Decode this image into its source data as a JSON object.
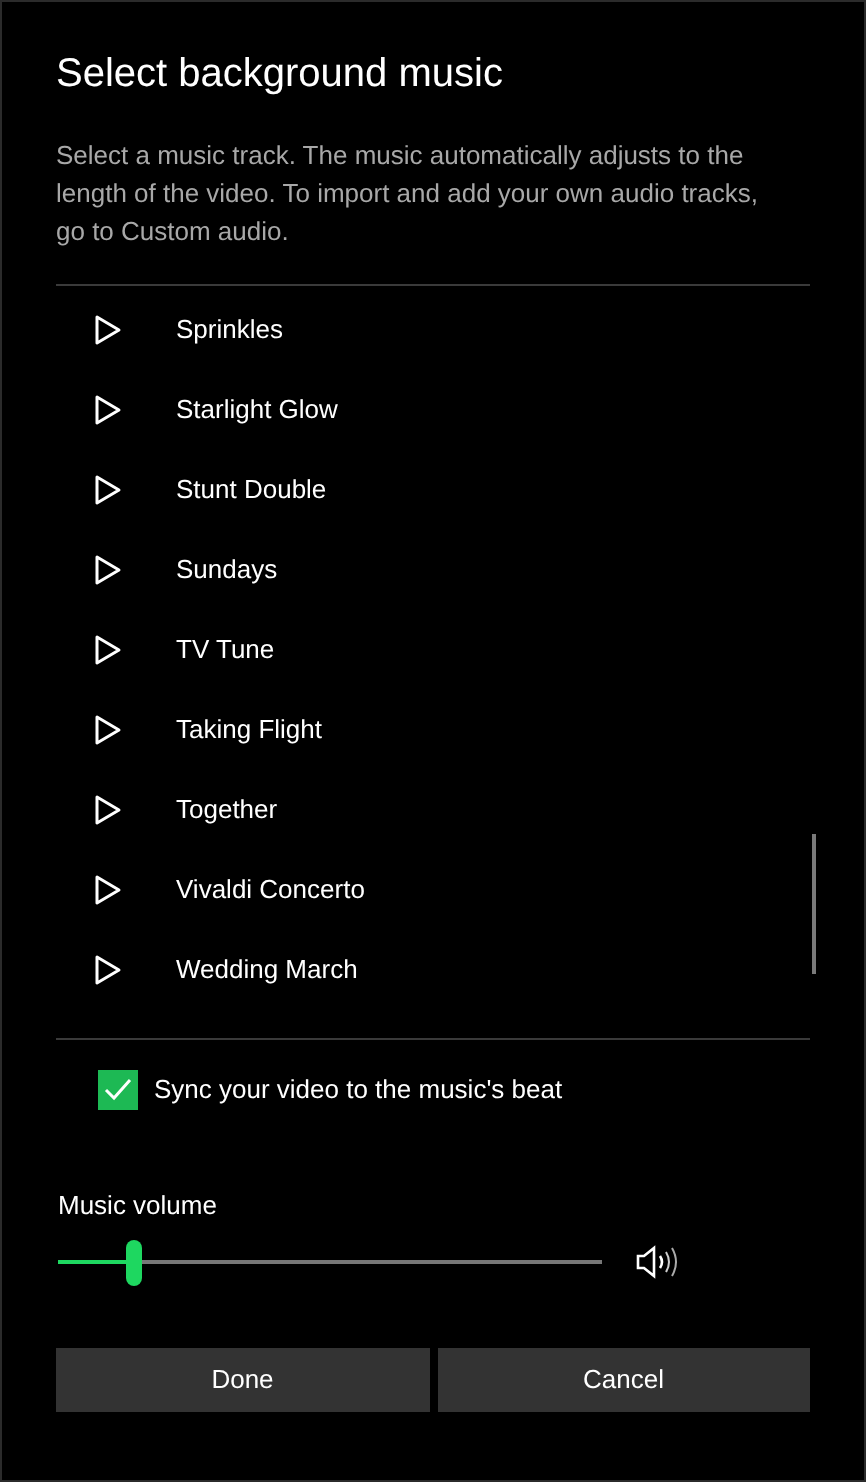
{
  "title": "Select background music",
  "description": "Select a music track. The music automatically adjusts to the length of the video. To import and add your own audio tracks, go to Custom audio.",
  "tracks": [
    {
      "name": "Sprinkles"
    },
    {
      "name": "Starlight Glow"
    },
    {
      "name": "Stunt Double"
    },
    {
      "name": "Sundays"
    },
    {
      "name": "TV Tune"
    },
    {
      "name": "Taking Flight"
    },
    {
      "name": "Together"
    },
    {
      "name": "Vivaldi Concerto"
    },
    {
      "name": "Wedding March"
    }
  ],
  "sync": {
    "label": "Sync your video to the music's beat",
    "checked": true
  },
  "volume": {
    "label": "Music volume",
    "level": 0.14
  },
  "buttons": [
    "Done",
    "Cancel"
  ]
}
